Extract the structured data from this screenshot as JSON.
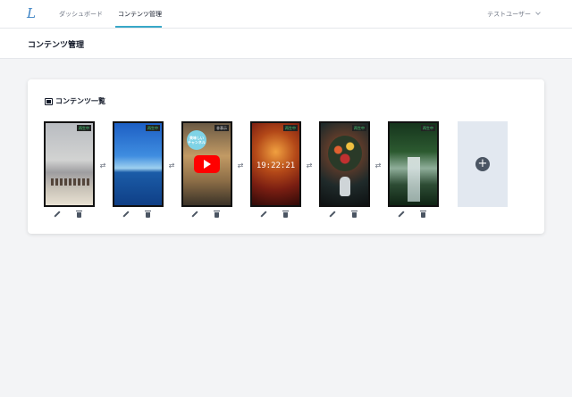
{
  "nav": {
    "logo": "L",
    "links": [
      "ダッシュボード",
      "コンテンツ管理"
    ],
    "user": "テストユーザー"
  },
  "page": {
    "title": "コンテンツ管理"
  },
  "card": {
    "title": "コンテンツ一覧"
  },
  "contents": [
    {
      "status": "再生中",
      "thumbnail": "beach-horses"
    },
    {
      "status": "再生中",
      "thumbnail": "ocean-sky"
    },
    {
      "status": "非表示",
      "thumbnail": "food-youtube",
      "badge": "美味しい\nチャンネル"
    },
    {
      "status": "再生中",
      "thumbnail": "clock-bokeh",
      "clock": "19:22:21"
    },
    {
      "status": "再生中",
      "thumbnail": "flower-vase"
    },
    {
      "status": "再生中",
      "thumbnail": "forest-waterfall"
    }
  ],
  "swap_symbol": "⇄",
  "add_symbol": "+",
  "colors": {
    "accent": "#38a8c8",
    "status_green": "#4ade80"
  }
}
